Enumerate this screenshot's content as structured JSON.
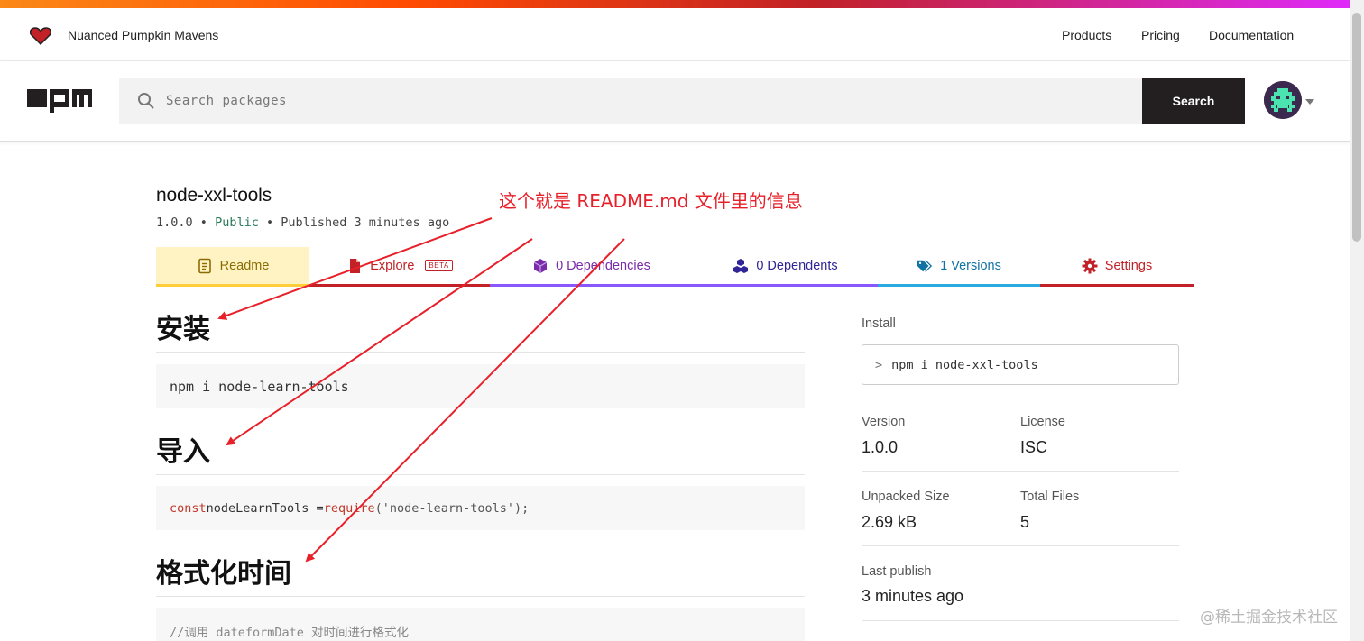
{
  "topnav": {
    "org_name": "Nuanced Pumpkin Mavens",
    "links": [
      "Products",
      "Pricing",
      "Documentation"
    ]
  },
  "search": {
    "placeholder": "Search packages",
    "button_label": "Search"
  },
  "package": {
    "name": "node-xxl-tools",
    "version": "1.0.0",
    "separator": "•",
    "visibility": "Public",
    "published": "Published 3 minutes ago"
  },
  "tabs": {
    "readme": "Readme",
    "explore": "Explore",
    "explore_badge": "BETA",
    "dependencies": "0 Dependencies",
    "dependents": "0 Dependents",
    "versions": "1 Versions",
    "settings": "Settings"
  },
  "readme": {
    "sections": [
      {
        "heading": "安装",
        "code": "npm i node-learn-tools"
      },
      {
        "heading": "导入",
        "code_keyword": "const",
        "code_rest": " nodeLearnTools = ",
        "code_require": "require",
        "code_arg": "('node-learn-tools');"
      },
      {
        "heading": "格式化时间",
        "code": "//调用 dateformDate 对时间进行格式化"
      }
    ]
  },
  "sidebar": {
    "install_label": "Install",
    "install_prompt": ">",
    "install_cmd": "npm i node-xxl-tools",
    "version_label": "Version",
    "version_value": "1.0.0",
    "license_label": "License",
    "license_value": "ISC",
    "unpacked_label": "Unpacked Size",
    "unpacked_value": "2.69 kB",
    "files_label": "Total Files",
    "files_value": "5",
    "last_publish_label": "Last publish",
    "last_publish_value": "3 minutes ago"
  },
  "annotation": {
    "text": "这个就是 README.md 文件里的信息",
    "color": "#e8202a"
  },
  "watermark": "@稀土掘金技术社区",
  "colors": {
    "npm_red": "#c12127",
    "readme_tab_bg": "#fff3c4",
    "search_button": "#231f20"
  },
  "icons": [
    "heart-icon",
    "npm-logo",
    "search-icon",
    "avatar",
    "readme-icon",
    "explore-icon",
    "dependencies-icon",
    "dependents-icon",
    "versions-icon",
    "settings-icon"
  ]
}
